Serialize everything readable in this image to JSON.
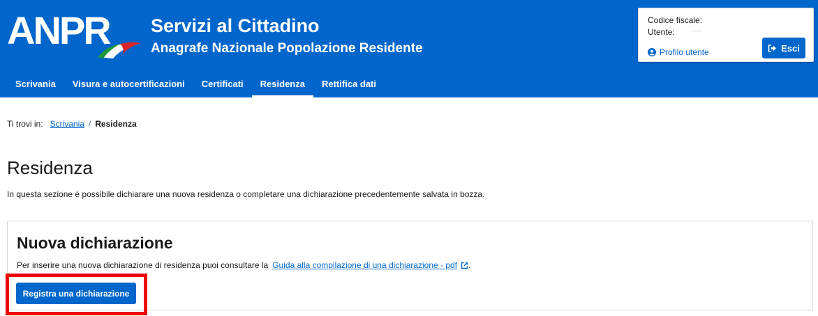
{
  "header": {
    "logo_text": "ANPR",
    "title": "Servizi al Cittadino",
    "subtitle": "Anagrafe Nazionale Popolazione Residente",
    "colors": {
      "primary": "#0066cc",
      "flag_green": "#1d9a3c",
      "flag_red": "#d7262e"
    }
  },
  "user_box": {
    "codice_fiscale_label": "Codice fiscale:",
    "utente_label": "Utente:",
    "profile_link": "Profilo utente",
    "logout_label": "Esci",
    "icons": {
      "profile": "user-circle-icon",
      "logout": "sign-out-icon"
    }
  },
  "nav": {
    "items": [
      {
        "label": "Scrivania"
      },
      {
        "label": "Visura e autocertificazioni"
      },
      {
        "label": "Certificati"
      },
      {
        "label": "Residenza",
        "active": true
      },
      {
        "label": "Rettifica dati"
      }
    ]
  },
  "breadcrumb": {
    "prefix": "Ti trovi in:",
    "link": "Scrivania",
    "separator": "/",
    "current": "Residenza"
  },
  "page": {
    "title": "Residenza",
    "description": "In questa sezione è possibile dichiarare una nuova residenza o completare una dichiarazione precedentemente salvata in bozza."
  },
  "card": {
    "title": "Nuova dichiarazione",
    "text": "Per inserire una nuova dichiarazione di residenza puoi consultare la",
    "link": "Guida alla compilazione di una dichiarazione - pdf",
    "link_suffix": ".",
    "button_label": "Registra una dichiarazione",
    "highlight_color": "#ee0000"
  }
}
